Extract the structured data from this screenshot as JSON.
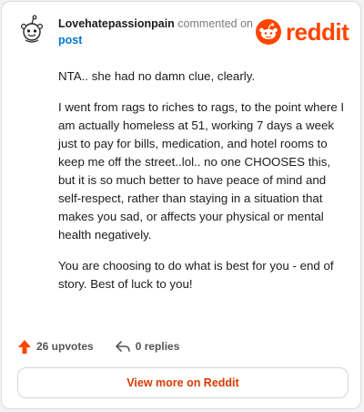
{
  "header": {
    "author": "Lovehatepassionpain",
    "action": "commented on",
    "post_link": "post"
  },
  "logo": {
    "word": "reddit",
    "brand_color": "#ff4500"
  },
  "comment": {
    "paragraphs": [
      "NTA.. she had no damn clue, clearly.",
      "I went from rags to riches to rags, to the point where I am actually homeless at 51, working 7 days a week just to pay for bills, medication, and hotel rooms to keep me off the street..lol.. no one CHOOSES this, but it is so much better to have peace of mind and self-respect, rather than staying in a situation that makes you sad, or affects your physical or mental health negatively.",
      "You are choosing to do what is best for you - end of story. Best of luck to you!"
    ]
  },
  "footer": {
    "upvotes": "26 upvotes",
    "replies": "0 replies",
    "upvote_color": "#ff4500"
  },
  "cta": {
    "label": "View more on Reddit",
    "color": "#d93a00"
  }
}
